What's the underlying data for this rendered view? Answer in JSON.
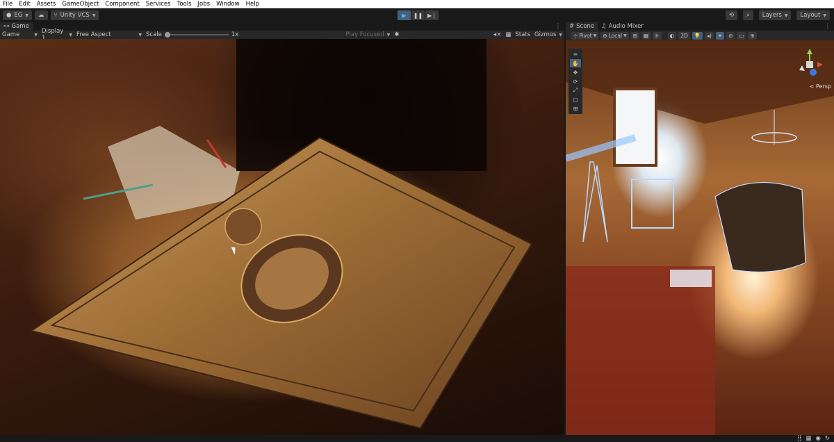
{
  "menubar": {
    "items": [
      "File",
      "Edit",
      "Assets",
      "GameObject",
      "Component",
      "Services",
      "Tools",
      "Jobs",
      "Window",
      "Help"
    ]
  },
  "toolbar": {
    "account_label": "EG",
    "vcs_label": "Unity VCS",
    "layers_label": "Layers",
    "layout_label": "Layout"
  },
  "game_panel": {
    "tab_label": "Game",
    "mode_label": "Game",
    "display_label": "Display 1",
    "aspect_label": "Free Aspect",
    "scale_label": "Scale",
    "scale_value": "1x",
    "play_focus_label": "Play Focused",
    "stats_label": "Stats",
    "gizmos_label": "Gizmos"
  },
  "scene_panel": {
    "tab_scene": "Scene",
    "tab_audio_mixer": "Audio Mixer",
    "pivot_label": "Pivot",
    "local_label": "Local",
    "mode_2d_label": "2D",
    "persp_label": "< Persp"
  },
  "colors": {
    "accent": "#46607c",
    "panel": "#282828",
    "chrome": "#191919"
  }
}
